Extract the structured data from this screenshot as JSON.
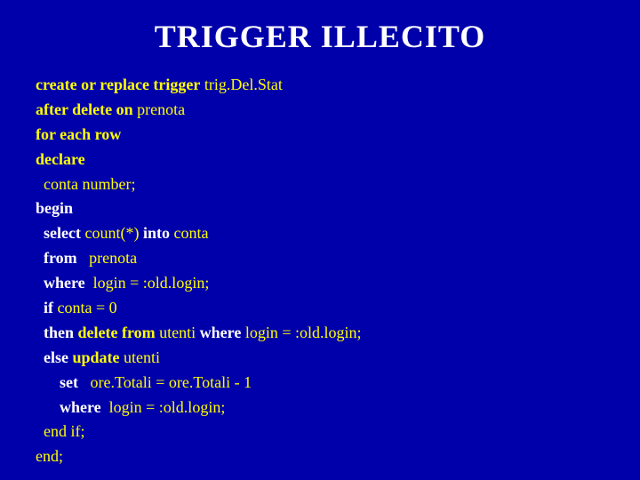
{
  "title": "TRIGGER ILLECITO",
  "code": {
    "lines": [
      {
        "id": "line1",
        "segments": [
          {
            "text": "create or replace trigger",
            "style": "yellow-bold"
          },
          {
            "text": " trig.Del.Stat",
            "style": "yellow"
          }
        ]
      },
      {
        "id": "line2",
        "segments": [
          {
            "text": "after delete on",
            "style": "yellow-bold"
          },
          {
            "text": " prenota",
            "style": "yellow"
          }
        ]
      },
      {
        "id": "line3",
        "segments": [
          {
            "text": "for each row",
            "style": "yellow-bold"
          }
        ]
      },
      {
        "id": "line4",
        "segments": [
          {
            "text": "declare",
            "style": "yellow-bold"
          }
        ]
      },
      {
        "id": "line5",
        "segments": [
          {
            "text": "  conta number;",
            "style": "yellow"
          }
        ]
      },
      {
        "id": "line6",
        "segments": [
          {
            "text": "begin",
            "style": "white-bold"
          }
        ]
      },
      {
        "id": "line7",
        "segments": [
          {
            "text": "  "
          },
          {
            "text": "select",
            "style": "white-bold"
          },
          {
            "text": " count(*) ",
            "style": "yellow"
          },
          {
            "text": "into",
            "style": "white-bold"
          },
          {
            "text": " conta",
            "style": "yellow"
          }
        ]
      },
      {
        "id": "line8",
        "segments": [
          {
            "text": "  "
          },
          {
            "text": "from",
            "style": "white-bold"
          },
          {
            "text": "   prenota",
            "style": "yellow"
          }
        ]
      },
      {
        "id": "line9",
        "segments": [
          {
            "text": "  "
          },
          {
            "text": "where",
            "style": "white-bold"
          },
          {
            "text": "  login = :old.login;",
            "style": "yellow"
          }
        ]
      },
      {
        "id": "line10",
        "segments": [
          {
            "text": "  "
          },
          {
            "text": "if",
            "style": "white-bold"
          },
          {
            "text": " conta = 0",
            "style": "yellow"
          }
        ]
      },
      {
        "id": "line11",
        "segments": [
          {
            "text": "  "
          },
          {
            "text": "then",
            "style": "white-bold"
          },
          {
            "text": " "
          },
          {
            "text": "delete from",
            "style": "yellow-bold"
          },
          {
            "text": " utenti ",
            "style": "yellow"
          },
          {
            "text": "where",
            "style": "white-bold"
          },
          {
            "text": " login = :old.login;",
            "style": "yellow"
          }
        ]
      },
      {
        "id": "line12",
        "segments": [
          {
            "text": "  "
          },
          {
            "text": "else",
            "style": "white-bold"
          },
          {
            "text": " "
          },
          {
            "text": "update",
            "style": "yellow-bold"
          },
          {
            "text": " utenti",
            "style": "yellow"
          }
        ]
      },
      {
        "id": "line13",
        "segments": [
          {
            "text": "      "
          },
          {
            "text": "set",
            "style": "white-bold"
          },
          {
            "text": "   ore.Totali = ore.Totali - 1",
            "style": "yellow"
          }
        ]
      },
      {
        "id": "line14",
        "segments": [
          {
            "text": "      "
          },
          {
            "text": "where",
            "style": "white-bold"
          },
          {
            "text": "  login = :old.login;",
            "style": "yellow"
          }
        ]
      },
      {
        "id": "line15",
        "segments": [
          {
            "text": "  "
          },
          {
            "text": "end if;",
            "style": "yellow"
          }
        ]
      },
      {
        "id": "line16",
        "segments": [
          {
            "text": "end;",
            "style": "yellow"
          }
        ]
      }
    ]
  }
}
